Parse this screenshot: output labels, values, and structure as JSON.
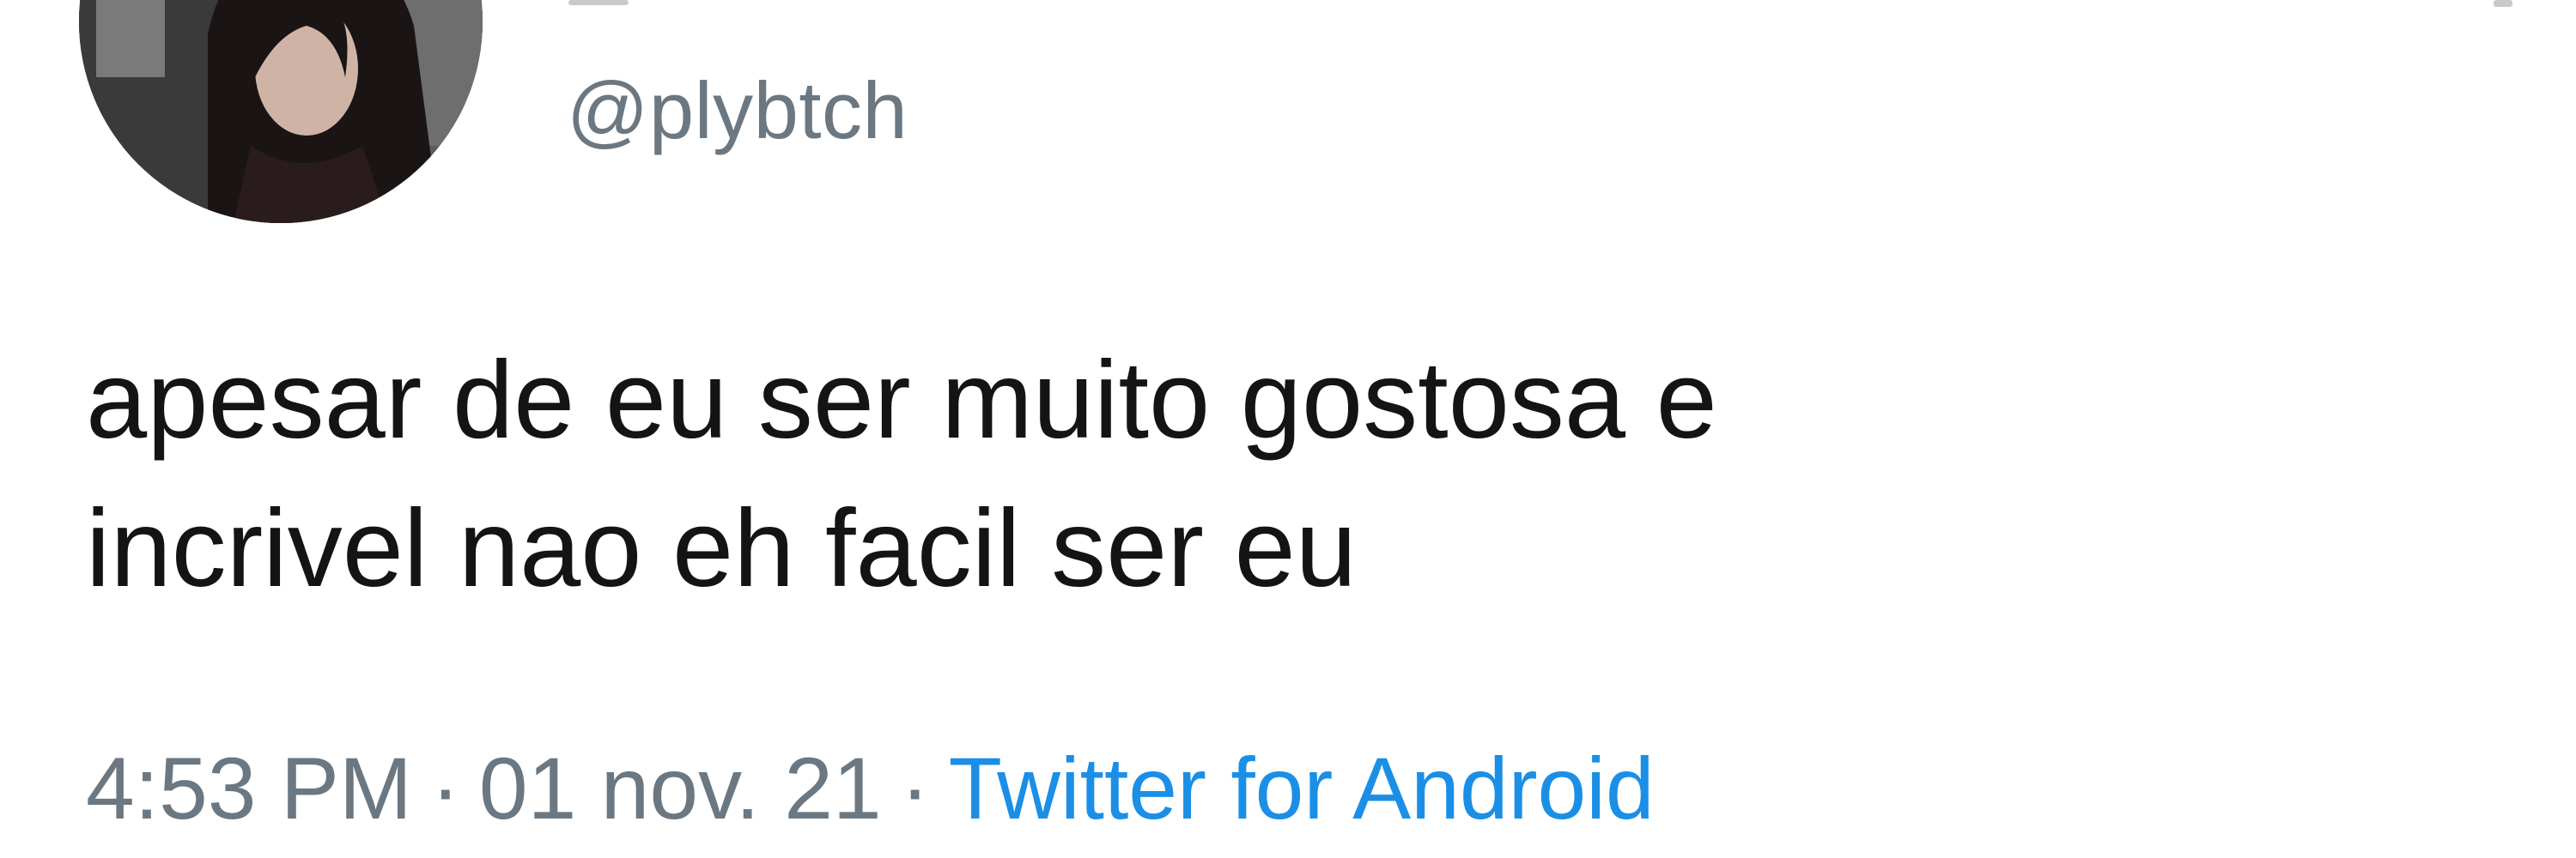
{
  "user": {
    "handle": "@plybtch"
  },
  "tweet": {
    "text_line1": "apesar de eu ser muito gostosa e",
    "text_line2": "incrivel nao eh facil ser eu"
  },
  "meta": {
    "time": "4:53 PM",
    "separator": "·",
    "date": "01 nov. 21",
    "source": "Twitter for Android"
  },
  "colors": {
    "text": "#141414",
    "muted": "#6b7781",
    "link": "#1b8fe6",
    "background": "#ffffff"
  },
  "icons": {
    "avatar": "profile-photo"
  }
}
